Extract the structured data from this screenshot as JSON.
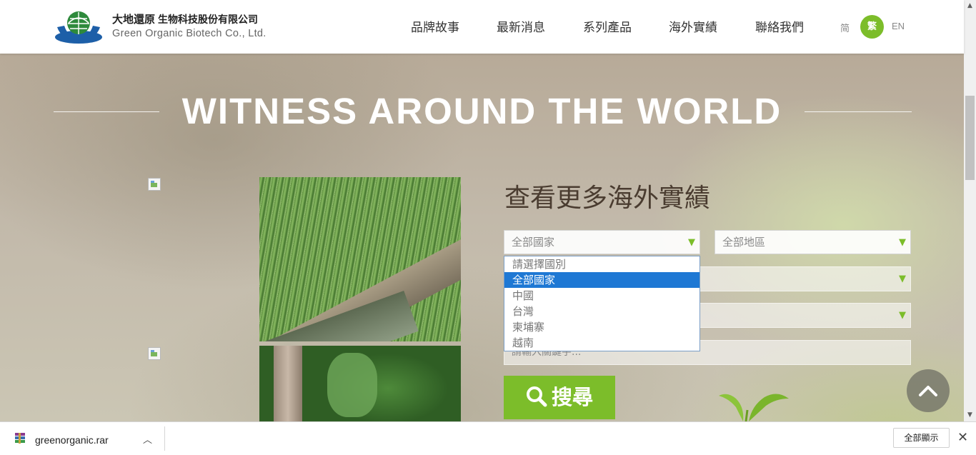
{
  "header": {
    "brand_cn": "大地還原",
    "brand_cn_sub": "生物科技股份有限公司",
    "brand_en": "Green Organic Biotech Co., Ltd.",
    "nav": [
      "品牌故事",
      "最新消息",
      "系列產品",
      "海外實績",
      "聯絡我們"
    ],
    "lang_simplified": "简",
    "lang_traditional": "繁",
    "lang_en": "EN"
  },
  "hero": {
    "title": "WITNESS AROUND THE WORLD"
  },
  "search": {
    "title": "查看更多海外實績",
    "country_value": "全部國家",
    "region_value": "全部地區",
    "keyword_placeholder": "請輸入關鍵字...",
    "button_label": "搜尋",
    "country_options": [
      "請選擇國別",
      "全部國家",
      "中國",
      "台灣",
      "柬埔寨",
      "越南"
    ]
  },
  "download_bar": {
    "file_name": "greenorganic.rar",
    "show_all": "全部顯示"
  },
  "colors": {
    "accent": "#7cbd2a",
    "selected_option": "#1e78d4"
  }
}
